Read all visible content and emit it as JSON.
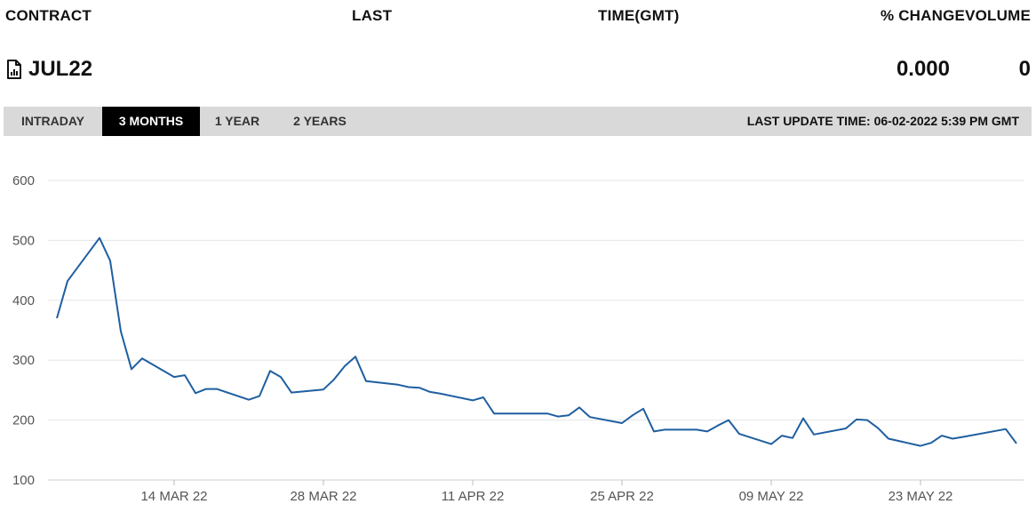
{
  "table": {
    "headers": {
      "contract": "CONTRACT",
      "last": "LAST",
      "time": "TIME(GMT)",
      "change": "% CHANGE",
      "volume": "VOLUME"
    },
    "row": {
      "icon": "document-chart-icon",
      "contract": "JUL22",
      "change": "0.000",
      "volume": "0"
    }
  },
  "tabs": [
    {
      "label": "INTRADAY",
      "active": false
    },
    {
      "label": "3 MONTHS",
      "active": true
    },
    {
      "label": "1 YEAR",
      "active": false
    },
    {
      "label": "2 YEARS",
      "active": false
    }
  ],
  "last_update": "LAST UPDATE TIME: 06-02-2022 5:39 PM GMT",
  "colors": {
    "line": "#1f5fa0",
    "grid": "#e6e6e6",
    "tab_bar": "#d9d9d9",
    "tab_active": "#000000"
  },
  "chart_data": {
    "type": "line",
    "title": "",
    "xlabel": "",
    "ylabel": "",
    "ylim": [
      100,
      600
    ],
    "yticks": [
      100,
      200,
      300,
      400,
      500,
      600
    ],
    "xticks": [
      "2022-03-14",
      "2022-03-28",
      "2022-04-11",
      "2022-04-25",
      "2022-05-09",
      "2022-05-23"
    ],
    "xtick_labels": [
      "14 MAR 22",
      "28 MAR 22",
      "11 APR 22",
      "25 APR 22",
      "09 MAY 22",
      "23 MAY 22"
    ],
    "grid": true,
    "legend": "none",
    "series": [
      {
        "x": [
          "2022-03-03",
          "2022-03-04",
          "2022-03-07",
          "2022-03-08",
          "2022-03-09",
          "2022-03-10",
          "2022-03-11",
          "2022-03-14",
          "2022-03-15",
          "2022-03-16",
          "2022-03-17",
          "2022-03-18",
          "2022-03-21",
          "2022-03-22",
          "2022-03-23",
          "2022-03-24",
          "2022-03-25",
          "2022-03-28",
          "2022-03-29",
          "2022-03-30",
          "2022-03-31",
          "2022-04-01",
          "2022-04-04",
          "2022-04-05",
          "2022-04-06",
          "2022-04-07",
          "2022-04-08",
          "2022-04-11",
          "2022-04-12",
          "2022-04-13",
          "2022-04-14",
          "2022-04-18",
          "2022-04-19",
          "2022-04-20",
          "2022-04-21",
          "2022-04-22",
          "2022-04-25",
          "2022-04-26",
          "2022-04-27",
          "2022-04-28",
          "2022-04-29",
          "2022-05-02",
          "2022-05-03",
          "2022-05-04",
          "2022-05-05",
          "2022-05-06",
          "2022-05-09",
          "2022-05-10",
          "2022-05-11",
          "2022-05-12",
          "2022-05-13",
          "2022-05-16",
          "2022-05-17",
          "2022-05-18",
          "2022-05-19",
          "2022-05-20",
          "2022-05-23",
          "2022-05-24",
          "2022-05-25",
          "2022-05-26",
          "2022-05-27",
          "2022-05-31",
          "2022-06-01"
        ],
        "values": [
          370,
          432,
          504,
          466,
          348,
          285,
          303,
          272,
          275,
          245,
          252,
          252,
          234,
          240,
          282,
          272,
          246,
          251,
          268,
          290,
          306,
          265,
          259,
          255,
          254,
          247,
          244,
          233,
          238,
          211,
          211,
          211,
          206,
          208,
          221,
          205,
          195,
          208,
          219,
          181,
          184,
          184,
          181,
          191,
          200,
          177,
          160,
          174,
          170,
          203,
          176,
          186,
          201,
          200,
          187,
          169,
          157,
          162,
          174,
          169,
          172,
          185,
          161
        ]
      }
    ]
  }
}
